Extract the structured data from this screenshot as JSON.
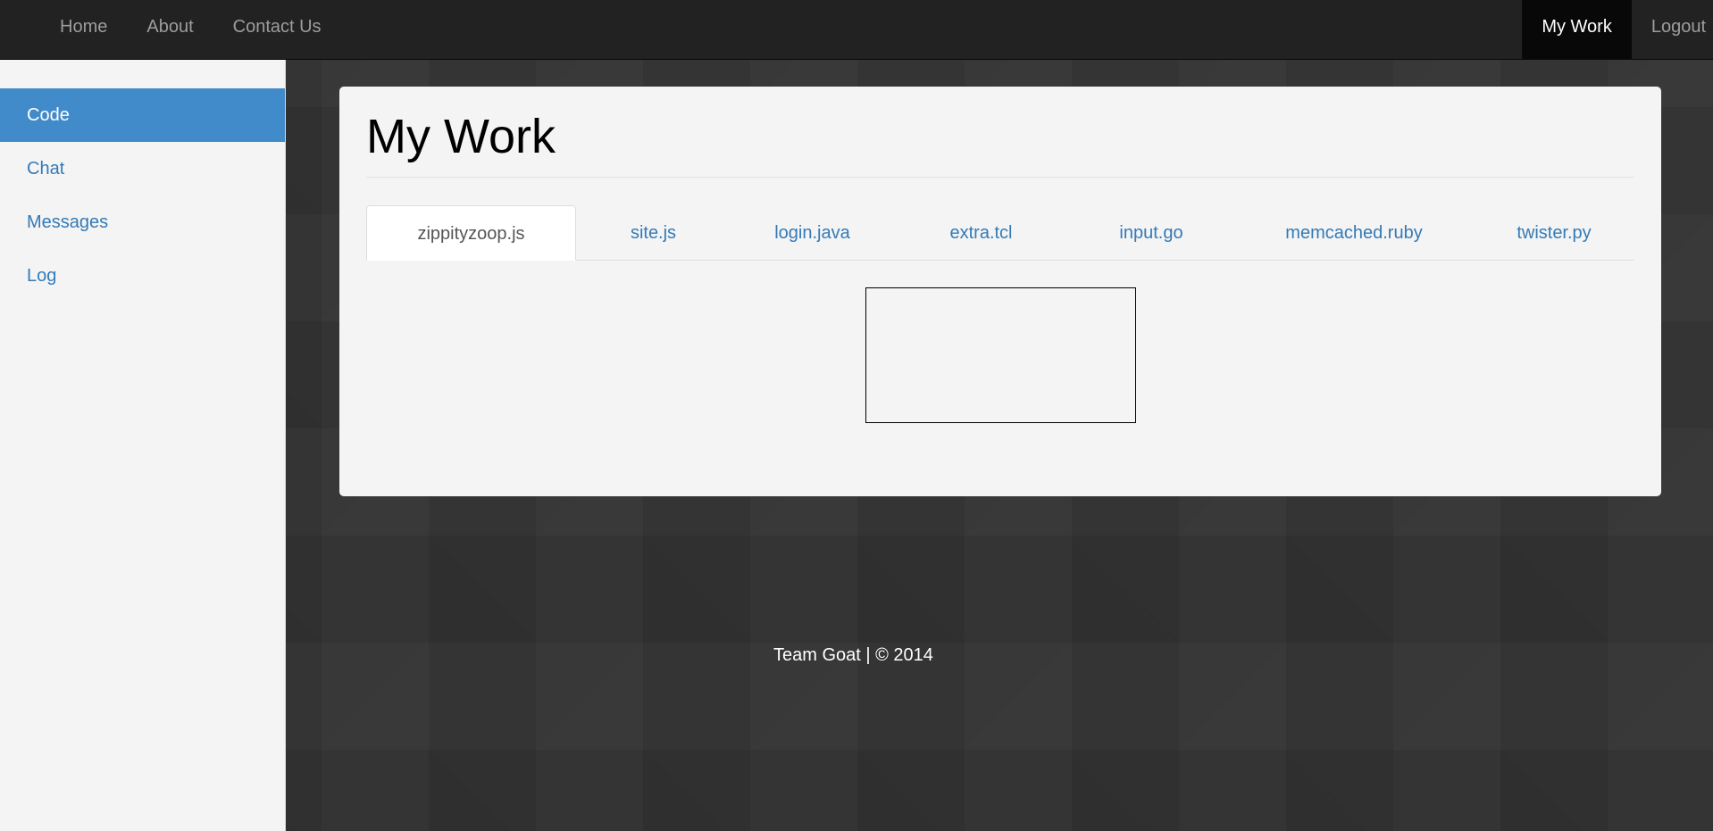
{
  "navbar": {
    "left_links": [
      "Home",
      "About",
      "Contact Us"
    ],
    "right_links": [
      "My Work",
      "Logout"
    ],
    "active": "My Work"
  },
  "sidebar": {
    "items": [
      "Code",
      "Chat",
      "Messages",
      "Log"
    ],
    "active": "Code"
  },
  "main": {
    "title": "My Work",
    "tabs": [
      "zippityzoop.js",
      "site.js",
      "login.java",
      "extra.tcl",
      "input.go",
      "memcached.ruby",
      "twister.py"
    ],
    "active_tab": "zippityzoop.js"
  },
  "footer": {
    "text": "Team Goat | © 2014"
  },
  "colors": {
    "navbar_bg": "#222222",
    "accent": "#428bca",
    "link": "#337ab7",
    "page_bg": "#343434",
    "panel_bg": "#f4f4f4"
  }
}
